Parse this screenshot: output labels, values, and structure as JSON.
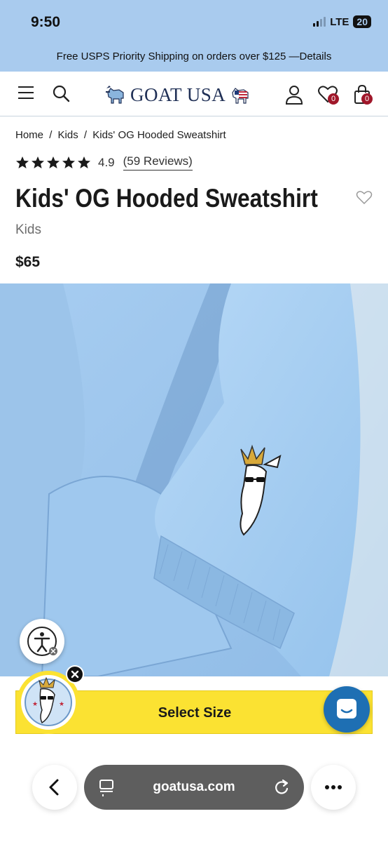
{
  "status_bar": {
    "time": "9:50",
    "network": "LTE",
    "battery": "20"
  },
  "promo": {
    "text": "Free USPS Priority Shipping on orders over $125 —Details"
  },
  "header": {
    "logo_text": "GOAT USA",
    "wishlist_count": "0",
    "cart_count": "0",
    "icons": [
      "menu-icon",
      "search-icon",
      "account-icon",
      "wishlist-icon",
      "bag-icon"
    ]
  },
  "breadcrumb": [
    {
      "label": "Home"
    },
    {
      "label": "/"
    },
    {
      "label": "Kids"
    },
    {
      "label": "/"
    },
    {
      "label": "Kids' OG Hooded Sweatshirt"
    }
  ],
  "product": {
    "rating": "4.9",
    "stars": 5,
    "reviews_label": "(59 Reviews)",
    "title": "Kids' OG Hooded Sweatshirt",
    "category": "Kids",
    "price": "$65"
  },
  "cta": {
    "select_size_label": "Select Size"
  },
  "browser": {
    "url": "goatusa.com"
  },
  "colors": {
    "top_bar": "#a9cbee",
    "cta_yellow": "#fbe232",
    "chat_blue": "#1e6fb3",
    "badge_red": "#a0172a",
    "sweatshirt_blue": "#9fc6ec"
  }
}
